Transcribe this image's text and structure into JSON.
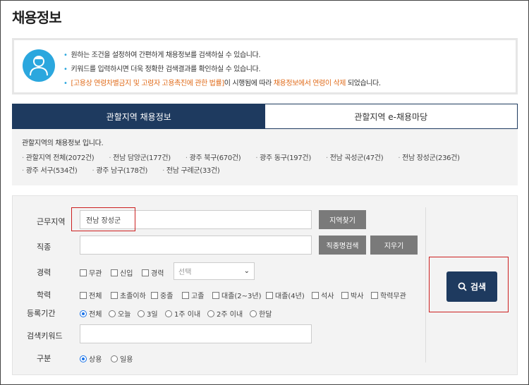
{
  "page": {
    "title": "채용정보"
  },
  "notice": {
    "line1": "원하는 조건을 설정하여 간편하게 채용정보를 검색하실 수 있습니다.",
    "line2": "키워드를 입력하시면 더욱 정확한 검색결과를 확인하실 수 있습니다.",
    "line3_law": "[고용상 연령차별금지 및 고령자 고용촉진에 관한 법률]",
    "line3_mid": "이 시행됨에 따라 ",
    "line3_hl": "채용정보에서 연령이 삭제",
    "line3_end": " 되었습니다."
  },
  "tabs": [
    {
      "label": "관할지역 채용정보"
    },
    {
      "label": "관할지역 e-채용마당"
    }
  ],
  "regions": {
    "intro": "관할지역의 채용정보 입니다.",
    "items": [
      "관할지역 전체(2072건)",
      "전남 담양군(177건)",
      "광주 북구(670건)",
      "광주 동구(197건)",
      "전남 곡성군(47건)",
      "전남 장성군(236건)",
      "광주 서구(534건)",
      "광주 남구(178건)",
      "전남 구례군(33건)"
    ]
  },
  "form": {
    "work_area_label": "근무지역",
    "work_area_value": "전남 장성군",
    "find_area_btn": "지역찾기",
    "job_label": "직종",
    "job_search_btn": "직종명검색",
    "clear_btn": "지우기",
    "career_label": "경력",
    "career_options": [
      "무관",
      "신입",
      "경력"
    ],
    "career_select": "선택",
    "edu_label": "학력",
    "edu_options": [
      "전체",
      "초졸이하",
      "중졸",
      "고졸",
      "대졸(2~3년)",
      "대졸(4년)",
      "석사",
      "박사",
      "학력무관"
    ],
    "period_label": "등록기간",
    "period_options": [
      "전체",
      "오늘",
      "3일",
      "1주 이내",
      "2주 이내",
      "한달"
    ],
    "keyword_label": "검색키워드",
    "type_label": "구분",
    "type_options": [
      "상용",
      "일용"
    ],
    "search_btn": "검색"
  },
  "colors": {
    "navy": "#1e3a5f",
    "accent": "#2ba7de",
    "orange": "#e06b1a",
    "red_outline": "#cc1f1f"
  }
}
